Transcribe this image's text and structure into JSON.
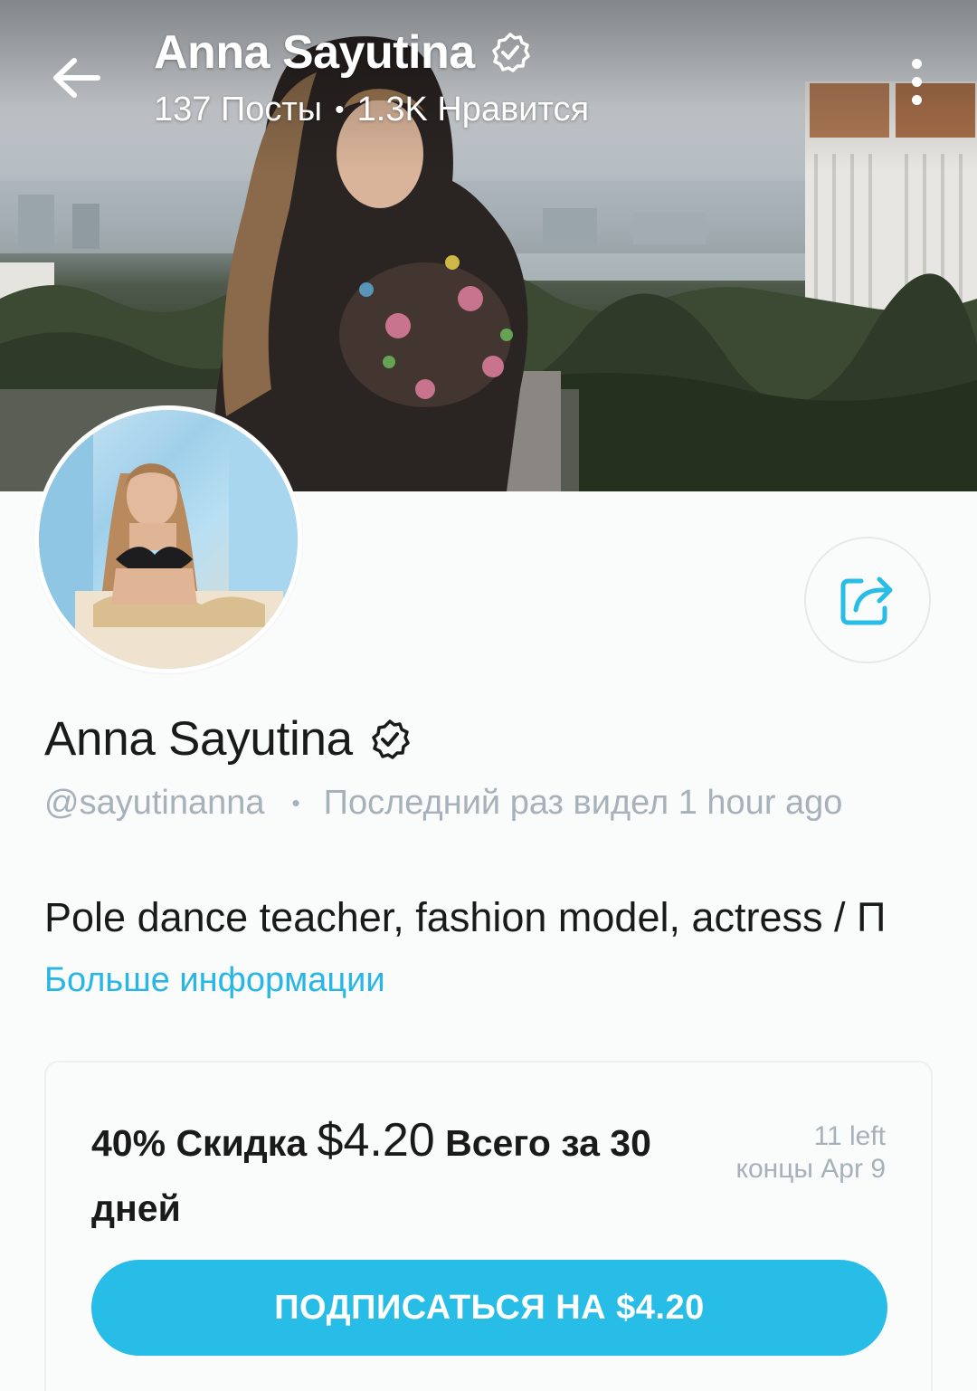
{
  "header": {
    "name": "Anna Sayutina",
    "posts": "137 Посты",
    "separator": "•",
    "likes": "1.3K Нравится"
  },
  "profile": {
    "name": "Anna Sayutina",
    "username": "@sayutinanna",
    "separator": "•",
    "last_seen": "Последний раз видел 1 hour ago",
    "bio": "Pole dance teacher, fashion model, actress / П",
    "more_info": "Больше информации"
  },
  "promo": {
    "discount": "40% Скидка",
    "price": "$4.20",
    "period": "Всего за 30 дней",
    "left": "11 left",
    "ends": "концы Apr 9",
    "subscribe_label": "ПОДПИСАТЬСЯ НА $4.20"
  },
  "colors": {
    "accent": "#27bde7",
    "link": "#27b6e6",
    "muted_text": "#a7b1ba",
    "text": "#1a1a1a",
    "background": "#fafbfb"
  },
  "icons": {
    "back": "arrow-left-icon",
    "more": "more-vertical-icon",
    "verified": "verified-badge-icon",
    "share": "share-icon"
  }
}
